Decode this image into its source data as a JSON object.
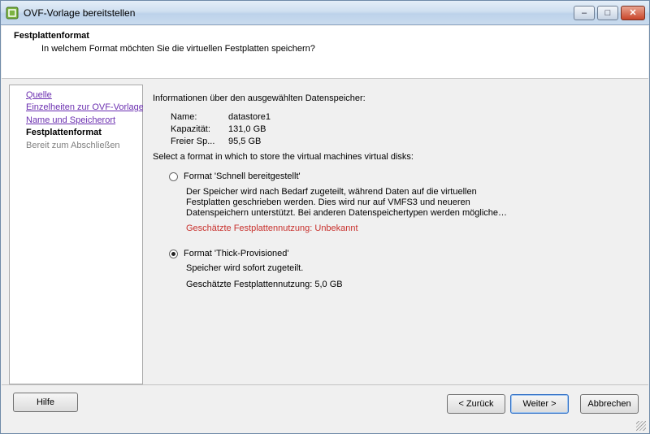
{
  "window": {
    "title": "OVF-Vorlage bereitstellen",
    "controls": {
      "minimize": "–",
      "maximize": "□",
      "close": "✕"
    }
  },
  "header": {
    "title": "Festplattenformat",
    "subtitle": "In welchem Format möchten Sie die virtuellen Festplatten speichern?"
  },
  "nav": {
    "items": [
      {
        "label": "Quelle",
        "state": "link"
      },
      {
        "label": "Einzelheiten zur OVF-Vorlage",
        "state": "link"
      },
      {
        "label": "Name und Speicherort",
        "state": "link"
      },
      {
        "label": "Festplattenformat",
        "state": "current"
      },
      {
        "label": "Bereit zum Abschließen",
        "state": "disabled"
      }
    ]
  },
  "content": {
    "info_heading": "Informationen über den ausgewählten Datenspeicher:",
    "datastore": {
      "name_label": "Name:",
      "name_value": "datastore1",
      "capacity_label": "Kapazität:",
      "capacity_value": "131,0 GB",
      "free_label": "Freier Sp...",
      "free_value": "95,5 GB"
    },
    "format_prompt": "Select a format in which to store the virtual machines virtual disks:",
    "options": [
      {
        "label": "Format 'Schnell bereitgestellt'",
        "checked": false,
        "description": [
          "Der Speicher wird nach Bedarf zugeteilt, während Daten auf die virtuellen",
          "Festplatten geschrieben werden. Dies wird nur auf VMFS3 und neueren",
          "Datenspeichern unterstützt. Bei anderen Datenspeichertypen werden mögliche…"
        ],
        "usage": "Geschätzte Festplattennutzung: Unbekannt"
      },
      {
        "label": "Format 'Thick-Provisioned'",
        "checked": true,
        "description": [
          "Speicher wird sofort zugeteilt."
        ],
        "usage": "Geschätzte Festplattennutzung: 5,0 GB"
      }
    ]
  },
  "footer": {
    "help": "Hilfe",
    "back": "< Zurück",
    "next": "Weiter >",
    "cancel": "Abbrechen"
  },
  "colors": {
    "link": "#6b2fb0",
    "warning": "#c8302c",
    "default_button_border": "#2a6bc4"
  }
}
